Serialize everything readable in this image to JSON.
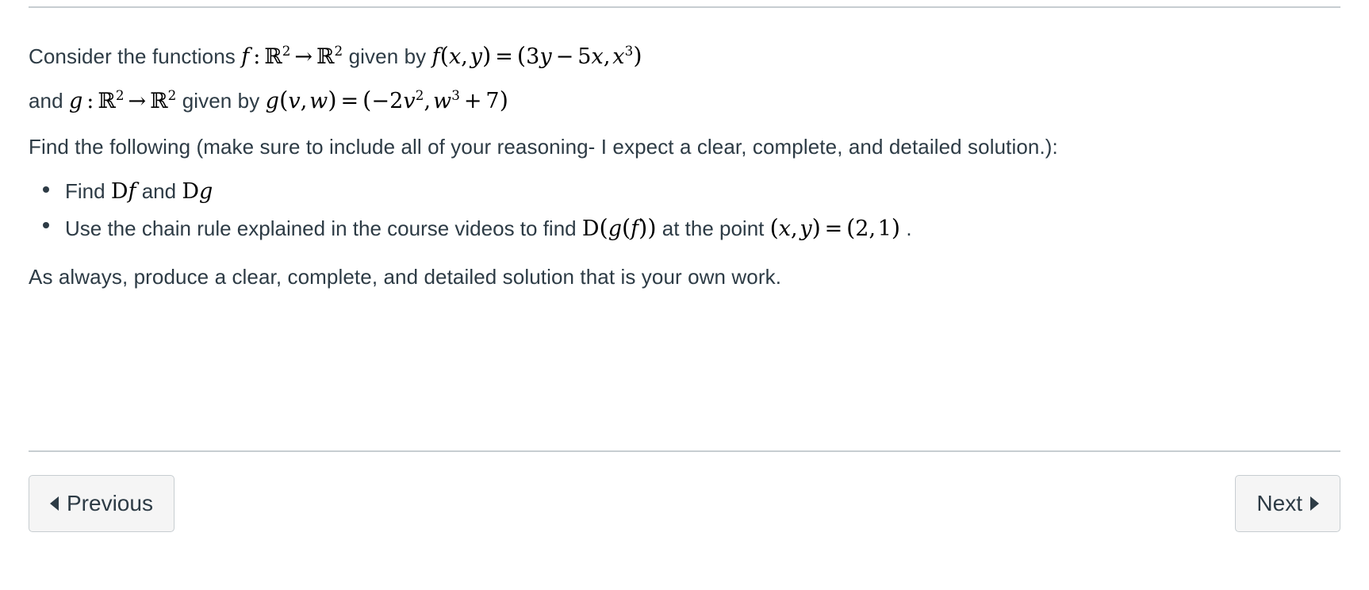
{
  "document": {
    "statement_line1_prefix": "Consider the functions",
    "statement_line1_mid": "given by",
    "statement_line2_prefix": "and",
    "statement_line2_mid": "given by",
    "prompt": "Find the following (make sure to include all of your reasoning- I expect a clear, complete, and detailed solution.):",
    "closing": "As always, produce a clear, complete, and detailed solution that is your own work.",
    "bullets": [
      {
        "text_before": "Find",
        "math1": "Df",
        "text_between": "and",
        "math2": "Dg",
        "text_after": ""
      },
      {
        "text_before": "Use the chain rule explained in the course videos to find",
        "math1": "D(g(f))",
        "text_between": "at the point",
        "math2": "(x, y) = (2, 1)",
        "text_after": "."
      }
    ],
    "math": {
      "f_map_domain": "R",
      "f_map_domain_exp": "2",
      "f_map_codomain": "R",
      "f_map_codomain_exp": "2",
      "f_name": "f",
      "f_def_args": "(x, y)",
      "f_def_body_term1": "3y",
      "f_def_body_minus": "−",
      "f_def_body_term2": "5x",
      "f_def_body_term3": "x",
      "f_def_body_term3_exp": "3",
      "g_name": "g",
      "g_def_args": "(v, w)",
      "g_def_body_term1": "−2v",
      "g_def_body_term1_exp": "2",
      "g_def_body_term2": "w",
      "g_def_body_term2_exp": "3",
      "g_def_body_plus": "+",
      "g_def_body_term3": "7",
      "arrow": "→",
      "colon": ":",
      "equals": "=",
      "comma": ",",
      "lparen": "(",
      "rparen": ")"
    }
  },
  "navigation": {
    "previous_label": "Previous",
    "next_label": "Next",
    "previous_icon": "triangle-left-icon",
    "next_icon": "triangle-right-icon"
  },
  "theme": {
    "text_color": "#2d3b45",
    "rule_color": "#c7cdd1",
    "button_bg": "#f5f5f5",
    "button_border": "#c7cdd1",
    "background": "#ffffff"
  }
}
